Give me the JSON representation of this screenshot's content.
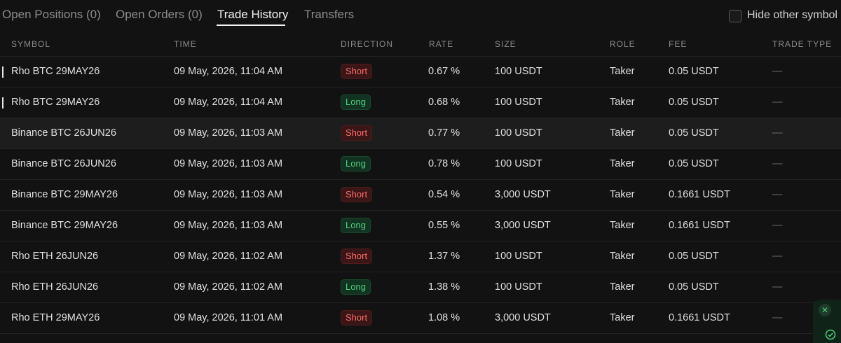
{
  "tabs": [
    {
      "label": "Open Positions (0)",
      "active": false
    },
    {
      "label": "Open Orders (0)",
      "active": false
    },
    {
      "label": "Trade History",
      "active": true
    },
    {
      "label": "Transfers",
      "active": false
    }
  ],
  "filter": {
    "hide_other_symbols_label": "Hide other symbol",
    "checked": false
  },
  "table": {
    "columns": [
      "SYMBOL",
      "TIME",
      "DIRECTION",
      "RATE",
      "SIZE",
      "ROLE",
      "FEE",
      "TRADE TYPE"
    ],
    "rows": [
      {
        "symbol": "Rho BTC 29MAY26",
        "time": "09 May, 2026, 11:04 AM",
        "direction": "Short",
        "rate": "0.67 %",
        "size": "100 USDT",
        "role": "Taker",
        "fee": "0.05 USDT",
        "trade_type": "—"
      },
      {
        "symbol": "Rho BTC 29MAY26",
        "time": "09 May, 2026, 11:04 AM",
        "direction": "Long",
        "rate": "0.68 %",
        "size": "100 USDT",
        "role": "Taker",
        "fee": "0.05 USDT",
        "trade_type": "—"
      },
      {
        "symbol": "Binance BTC 26JUN26",
        "time": "09 May, 2026, 11:03 AM",
        "direction": "Short",
        "rate": "0.77 %",
        "size": "100 USDT",
        "role": "Taker",
        "fee": "0.05 USDT",
        "trade_type": "—"
      },
      {
        "symbol": "Binance BTC 26JUN26",
        "time": "09 May, 2026, 11:03 AM",
        "direction": "Long",
        "rate": "0.78 %",
        "size": "100 USDT",
        "role": "Taker",
        "fee": "0.05 USDT",
        "trade_type": "—"
      },
      {
        "symbol": "Binance BTC 29MAY26",
        "time": "09 May, 2026, 11:03 AM",
        "direction": "Short",
        "rate": "0.54 %",
        "size": "3,000 USDT",
        "role": "Taker",
        "fee": "0.1661 USDT",
        "trade_type": "—"
      },
      {
        "symbol": "Binance BTC 29MAY26",
        "time": "09 May, 2026, 11:03 AM",
        "direction": "Long",
        "rate": "0.55 %",
        "size": "3,000 USDT",
        "role": "Taker",
        "fee": "0.1661 USDT",
        "trade_type": "—"
      },
      {
        "symbol": "Rho ETH 26JUN26",
        "time": "09 May, 2026, 11:02 AM",
        "direction": "Short",
        "rate": "1.37 %",
        "size": "100 USDT",
        "role": "Taker",
        "fee": "0.05 USDT",
        "trade_type": "—"
      },
      {
        "symbol": "Rho ETH 26JUN26",
        "time": "09 May, 2026, 11:02 AM",
        "direction": "Long",
        "rate": "1.38 %",
        "size": "100 USDT",
        "role": "Taker",
        "fee": "0.05 USDT",
        "trade_type": "—"
      },
      {
        "symbol": "Rho ETH 29MAY26",
        "time": "09 May, 2026, 11:01 AM",
        "direction": "Short",
        "rate": "1.08 %",
        "size": "3,000 USDT",
        "role": "Taker",
        "fee": "0.1661 USDT",
        "trade_type": "—"
      }
    ]
  },
  "icons": {
    "widget_close": "close-icon",
    "widget_status": "check-circle-icon"
  },
  "colors": {
    "short": "#ff6b6b",
    "long": "#4fd17a",
    "background": "#121212"
  }
}
